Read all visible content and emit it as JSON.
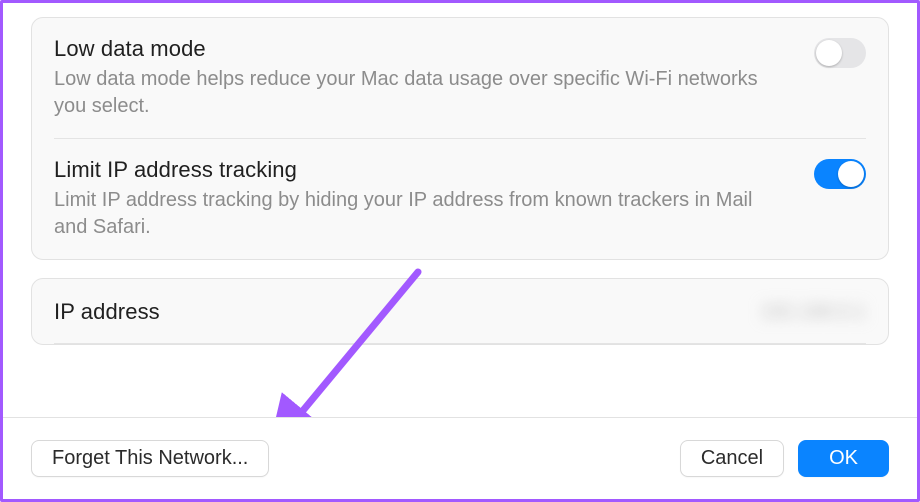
{
  "settings": {
    "lowData": {
      "title": "Low data mode",
      "desc": "Low data mode helps reduce your Mac data usage over specific Wi-Fi networks you select.",
      "enabled": false
    },
    "limitIP": {
      "title": "Limit IP address tracking",
      "desc": "Limit IP address tracking by hiding your IP address from known trackers in Mail and Safari.",
      "enabled": true
    },
    "ip": {
      "label": "IP address",
      "value": "192.168.0.1"
    }
  },
  "footer": {
    "forget": "Forget This Network...",
    "cancel": "Cancel",
    "ok": "OK"
  },
  "colors": {
    "accent": "#0a84ff",
    "annotation": "#a259ff"
  }
}
